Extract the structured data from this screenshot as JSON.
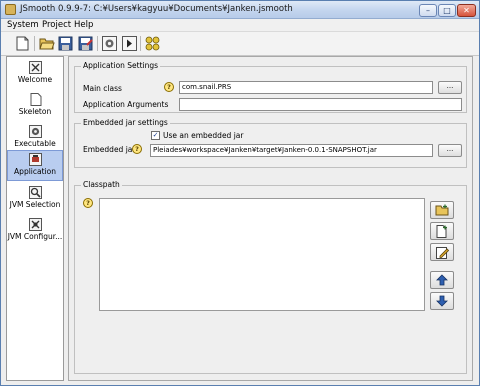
{
  "window": {
    "title": "JSmooth 0.9.9-7: C:¥Users¥kagyuu¥Documents¥Janken.jsmooth",
    "minimize_glyph": "–",
    "maximize_glyph": "□",
    "close_glyph": "✕"
  },
  "menubar": {
    "items": [
      {
        "label": "System"
      },
      {
        "label": "Project"
      },
      {
        "label": "Help"
      }
    ]
  },
  "toolbar": {
    "icons": [
      "new-file-icon",
      "open-folder-icon",
      "save-icon",
      "save-as-icon",
      "settings-gear-icon",
      "run-icon",
      "compile-icon"
    ]
  },
  "sidebar": {
    "items": [
      {
        "label": "Welcome",
        "icon": "welcome-icon",
        "active": false
      },
      {
        "label": "Skeleton",
        "icon": "skeleton-icon",
        "active": false
      },
      {
        "label": "Executable",
        "icon": "executable-icon",
        "active": false
      },
      {
        "label": "Application",
        "icon": "application-icon",
        "active": true
      },
      {
        "label": "JVM Selection",
        "icon": "jvm-selection-icon",
        "active": false
      },
      {
        "label": "JVM Configur...",
        "icon": "jvm-configuration-icon",
        "active": false
      }
    ]
  },
  "app_settings": {
    "title": "Application Settings",
    "main_class_label": "Main class",
    "main_class_value": "com.snail.PRS",
    "browse_label": "...",
    "args_label": "Application Arguments",
    "args_value": ""
  },
  "jar_settings": {
    "title": "Embedded jar settings",
    "embedded_jar_label": "Embedded jar",
    "use_embedded_label": "Use an embedded jar",
    "use_embedded_checked": true,
    "check_glyph": "✓",
    "jar_path_value": "Pleiades¥workspace¥Janken¥target¥Janken-0.0.1-SNAPSHOT.jar",
    "browse_label": "..."
  },
  "classpath": {
    "title": "Classpath",
    "items": []
  },
  "help_glyph": "?"
}
